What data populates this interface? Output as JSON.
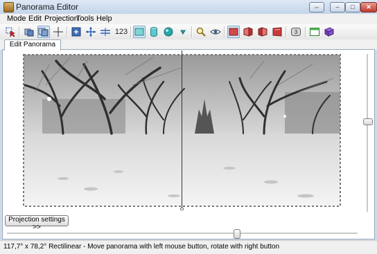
{
  "window": {
    "title": "Panorama Editor",
    "controls": {
      "restore_label": "⇔",
      "minimize_label": "–",
      "maximize_label": "□",
      "close_label": "✕"
    }
  },
  "menu": [
    "Mode",
    "Edit",
    "Projection",
    "Tools",
    "Help"
  ],
  "toolbar": {
    "buttons": [
      {
        "icon": "select-control-points-icon",
        "active": false
      },
      {
        "icon": "images-icon",
        "active": false
      },
      {
        "icon": "mask-icon",
        "active": true
      },
      {
        "icon": "crosshair-icon",
        "active": false
      },
      {
        "icon": "fit-icon",
        "active": false
      },
      {
        "icon": "center-icon",
        "active": false
      },
      {
        "icon": "straighten-icon",
        "active": false
      },
      {
        "icon": "number-icon",
        "active": false
      },
      {
        "icon": "rectilinear-icon",
        "active": true
      },
      {
        "icon": "cylindrical-icon",
        "active": false
      },
      {
        "icon": "sphere-icon",
        "active": false
      },
      {
        "icon": "triangle-icon",
        "active": false
      },
      {
        "icon": "zoom-icon",
        "active": false
      },
      {
        "icon": "eye-icon",
        "active": false
      },
      {
        "icon": "book-flat-icon",
        "active": true
      },
      {
        "icon": "book-left-icon",
        "active": false
      },
      {
        "icon": "book-right-icon",
        "active": false
      },
      {
        "icon": "book-open-icon",
        "active": false
      },
      {
        "icon": "layer-count-icon",
        "active": false
      },
      {
        "icon": "preview-window-icon",
        "active": false
      },
      {
        "icon": "identify-icon",
        "active": false
      }
    ],
    "number_label": "123",
    "layer_count": "3"
  },
  "tabs": {
    "edit_panorama": "Edit Panorama"
  },
  "buttons": {
    "projection_settings": "Projection settings >>"
  },
  "status": {
    "text": "117,7° x 78,2° Rectilinear - Move panorama with left mouse button, rotate with right button"
  },
  "colors": {
    "accent": "#7fa6cf",
    "sky": "#b7b7b7",
    "snow": "#efefef",
    "trees": "#3a3a3a"
  }
}
